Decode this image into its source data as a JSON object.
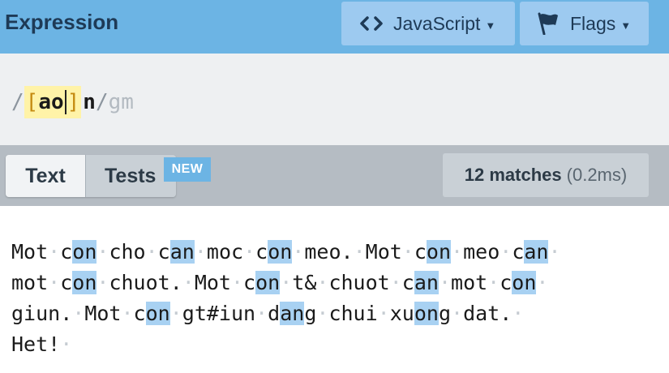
{
  "header": {
    "title": "Expression",
    "flavor_label": "JavaScript",
    "flags_label": "Flags"
  },
  "expression": {
    "open_delim": "/",
    "set_open": "[",
    "set_chars": "ao",
    "set_close": "]",
    "literal": "n",
    "close_delim": "/",
    "flags": "gm"
  },
  "tabs": {
    "text_label": "Text",
    "tests_label": "Tests",
    "new_badge": "NEW"
  },
  "results": {
    "match_count": "12 matches",
    "time": "(0.2ms)"
  },
  "colors": {
    "header_bg": "#6cb4e4",
    "match_highlight": "#a8d1f2",
    "set_highlight": "#fff3a8"
  },
  "text_lines": [
    [
      {
        "t": "Mot"
      },
      {
        "t": "·",
        "dot": true
      },
      {
        "t": "c"
      },
      {
        "t": "on",
        "m": true
      },
      {
        "t": "·",
        "dot": true
      },
      {
        "t": "cho"
      },
      {
        "t": "·",
        "dot": true
      },
      {
        "t": "c"
      },
      {
        "t": "an",
        "m": true
      },
      {
        "t": "·",
        "dot": true
      },
      {
        "t": "moc"
      },
      {
        "t": "·",
        "dot": true
      },
      {
        "t": "c"
      },
      {
        "t": "on",
        "m": true
      },
      {
        "t": "·",
        "dot": true
      },
      {
        "t": "meo."
      },
      {
        "t": "·",
        "dot": true
      },
      {
        "t": "Mot"
      },
      {
        "t": "·",
        "dot": true
      },
      {
        "t": "c"
      },
      {
        "t": "on",
        "m": true
      },
      {
        "t": "·",
        "dot": true
      },
      {
        "t": "meo"
      },
      {
        "t": "·",
        "dot": true
      },
      {
        "t": "c"
      },
      {
        "t": "an",
        "m": true
      },
      {
        "t": "·",
        "dot": true
      }
    ],
    [
      {
        "t": "mot"
      },
      {
        "t": "·",
        "dot": true
      },
      {
        "t": "c"
      },
      {
        "t": "on",
        "m": true
      },
      {
        "t": "·",
        "dot": true
      },
      {
        "t": "chuot."
      },
      {
        "t": "·",
        "dot": true
      },
      {
        "t": "Mot"
      },
      {
        "t": "·",
        "dot": true
      },
      {
        "t": "c"
      },
      {
        "t": "on",
        "m": true
      },
      {
        "t": "·",
        "dot": true
      },
      {
        "t": "t&"
      },
      {
        "t": "·",
        "dot": true
      },
      {
        "t": "chuot"
      },
      {
        "t": "·",
        "dot": true
      },
      {
        "t": "c"
      },
      {
        "t": "an",
        "m": true
      },
      {
        "t": "·",
        "dot": true
      },
      {
        "t": "mot"
      },
      {
        "t": "·",
        "dot": true
      },
      {
        "t": "c"
      },
      {
        "t": "on",
        "m": true
      },
      {
        "t": "·",
        "dot": true
      }
    ],
    [
      {
        "t": "giun."
      },
      {
        "t": "·",
        "dot": true
      },
      {
        "t": "Mot"
      },
      {
        "t": "·",
        "dot": true
      },
      {
        "t": "c"
      },
      {
        "t": "on",
        "m": true
      },
      {
        "t": "·",
        "dot": true
      },
      {
        "t": "gt#iun"
      },
      {
        "t": "·",
        "dot": true
      },
      {
        "t": "d"
      },
      {
        "t": "an",
        "m": true
      },
      {
        "t": "g"
      },
      {
        "t": "·",
        "dot": true
      },
      {
        "t": "chui"
      },
      {
        "t": "·",
        "dot": true
      },
      {
        "t": "xu"
      },
      {
        "t": "on",
        "m": true
      },
      {
        "t": "g"
      },
      {
        "t": "·",
        "dot": true
      },
      {
        "t": "dat."
      },
      {
        "t": "·",
        "dot": true
      }
    ],
    [
      {
        "t": "Het!"
      },
      {
        "t": "·",
        "dot": true
      }
    ]
  ]
}
